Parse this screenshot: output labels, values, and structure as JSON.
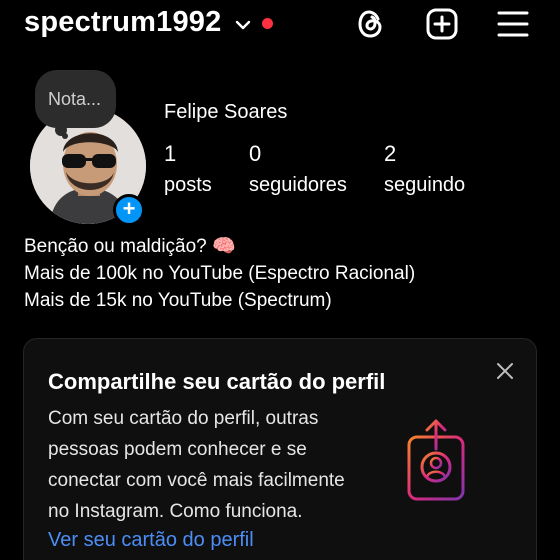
{
  "header": {
    "username": "spectrum1992",
    "notification_color": "#ff3040",
    "icons": [
      "chevron-down-icon",
      "threads-icon",
      "add-post-icon",
      "menu-icon"
    ]
  },
  "profile": {
    "note": "Nota...",
    "full_name": "Felipe Soares",
    "stats": [
      {
        "value": "1",
        "label": "posts"
      },
      {
        "value": "0",
        "label": "seguidores"
      },
      {
        "value": "2",
        "label": "seguindo"
      }
    ],
    "bio_lines": [
      "Benção ou maldição? 🧠",
      "Mais de 100k no YouTube (Espectro Racional)",
      "Mais de 15k no YouTube (Spectrum)"
    ]
  },
  "share_card": {
    "title": "Compartilhe seu cartão do perfil",
    "text_lines": [
      "Com seu cartão do perfil, outras",
      "pessoas podem conhecer e se",
      "conectar com você mais facilmente",
      "no Instagram. Como funciona."
    ],
    "link": "Ver seu cartão do perfil",
    "accent": "#4c8ef5"
  }
}
